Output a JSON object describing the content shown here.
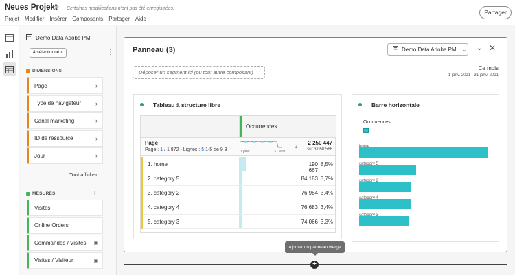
{
  "header": {
    "project_title": "Neues Projekt",
    "save_message": "Certaines modifications n'ont pas été enregistrées.",
    "menu": [
      "Projet",
      "Modifier",
      "Insérer",
      "Composants",
      "Partager",
      "Aide"
    ],
    "share_label": "Partager"
  },
  "rail": {
    "icons": [
      "panels-icon",
      "visualizations-icon",
      "components-icon"
    ]
  },
  "components": {
    "data_view": "Demo Data Adobe PM",
    "selection_chip": "4 sélectionné",
    "dimensions_label": "DIMENSIONS",
    "dimensions": [
      "Page",
      "Type de navigateur",
      "Canal marketing",
      "ID de ressource",
      "Jour"
    ],
    "show_all": "Tout afficher",
    "metrics_label": "MESURES",
    "metrics": [
      "Visites",
      "Online Orders",
      "Commandes / Visites",
      "Visites / Visiteur"
    ]
  },
  "panel": {
    "title": "Panneau (3)",
    "data_view": "Demo Data Adobe PM",
    "segment_dropzone": "Déposer un segment ici (ou tout autre composant)",
    "date_label": "Ce mois",
    "date_range": "1 janv. 2021 - 31 janv. 2021"
  },
  "freeform": {
    "title": "Tableau à structure libre",
    "metric_name": "Occurrences",
    "dimension_name": "Page",
    "pager": {
      "page_word": "Page :",
      "page_current": "1",
      "page_total": "/ 1 872",
      "lines_word": "Lignes :",
      "lines_value": "5",
      "range": "1-5 de 9 3"
    },
    "spark_start": "1 janv.",
    "spark_end": "31 janv.",
    "total": "2 250 447",
    "total_sub": "sur 3 050 566",
    "rows": [
      {
        "label": "1. home",
        "value": "190 667",
        "pct": "8,5%",
        "share": 0.085
      },
      {
        "label": "2. category 5",
        "value": "84 183",
        "pct": "3,7%",
        "share": 0.037
      },
      {
        "label": "3. category 2",
        "value": "76 984",
        "pct": "3,4%",
        "share": 0.034
      },
      {
        "label": "4. category 4",
        "value": "76 683",
        "pct": "3,4%",
        "share": 0.034
      },
      {
        "label": "5. category 3",
        "value": "74 066",
        "pct": "3,3%",
        "share": 0.033
      }
    ]
  },
  "chart_data": {
    "type": "bar",
    "title": "Barre horizontale",
    "orientation": "horizontal",
    "series": [
      {
        "name": "Occurrences",
        "values": [
          190667,
          84183,
          76984,
          76683,
          74066
        ]
      }
    ],
    "categories": [
      "home",
      "category 5",
      "category 2",
      "category 4",
      "category 3"
    ],
    "color": "#2dc0c9"
  },
  "footer": {
    "tooltip": "Ajouter un panneau vierge"
  }
}
